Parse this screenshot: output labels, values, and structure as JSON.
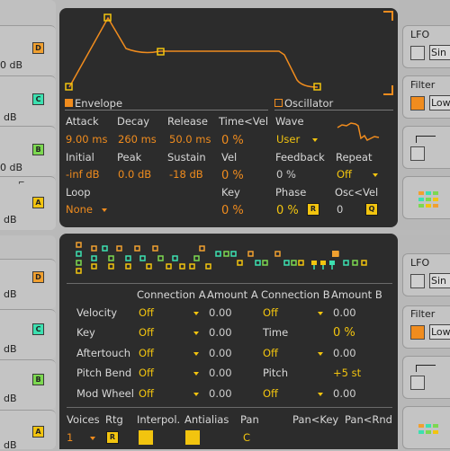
{
  "left_strip": {
    "ends": [
      "0 dB",
      "dB",
      "0 dB",
      "dB",
      "dB",
      "dB",
      "dB",
      "0 dB",
      "dB",
      "0 dB",
      "dB",
      "dB"
    ],
    "leds": [
      "D",
      "C",
      "B",
      "A",
      "D",
      "C",
      "B",
      "A"
    ]
  },
  "right_strip": {
    "lfo_label": "LFO",
    "lfo_value": "Sin",
    "filter_label": "Filter",
    "filter_value": "Low",
    "lfo2_label": "LFO",
    "lfo2_value": "Sin",
    "filter2_label": "Filter",
    "filter2_value": "Low"
  },
  "envelope": {
    "tab_label": "Envelope",
    "attack_label": "Attack",
    "attack_value": "9.00 ms",
    "decay_label": "Decay",
    "decay_value": "260 ms",
    "release_label": "Release",
    "release_value": "50.0 ms",
    "timevel_label": "Time<Vel",
    "timevel_value": "0 %",
    "initial_label": "Initial",
    "initial_value": "-inf dB",
    "peak_label": "Peak",
    "peak_value": "0.0 dB",
    "sustain_label": "Sustain",
    "sustain_value": "-18 dB",
    "vel_label": "Vel",
    "vel_value": "0 %",
    "loop_label": "Loop",
    "loop_value": "None",
    "key_label": "Key",
    "key_value": "0 %"
  },
  "oscillator": {
    "tab_label": "Oscillator",
    "wave_label": "Wave",
    "wave_value": "User",
    "feedback_label": "Feedback",
    "feedback_value": "0 %",
    "repeat_label": "Repeat",
    "repeat_value": "Off",
    "phase_label": "Phase",
    "phase_value": "0 %",
    "phase_btn": "R",
    "oscvel_label": "Osc<Vel",
    "oscvel_value": "0",
    "oscvel_btn": "Q"
  },
  "matrix": {
    "headers": [
      "Connection A",
      "Amount A",
      "Connection B",
      "Amount B"
    ],
    "rows": [
      {
        "label": "Velocity",
        "conn_a": "Off",
        "amt_a": "0.00",
        "conn_b": "Off",
        "amt_b": "0.00"
      },
      {
        "label": "Key",
        "conn_a": "Off",
        "amt_a": "0.00",
        "conn_b": "Time",
        "amt_b": "0 %"
      },
      {
        "label": "Aftertouch",
        "conn_a": "Off",
        "amt_a": "0.00",
        "conn_b": "Off",
        "amt_b": "0.00"
      },
      {
        "label": "Pitch Bend",
        "conn_a": "Off",
        "amt_a": "0.00",
        "conn_b": "Pitch",
        "amt_b": "+5 st"
      },
      {
        "label": "Mod Wheel",
        "conn_a": "Off",
        "amt_a": "0.00",
        "conn_b": "Off",
        "amt_b": "0.00"
      }
    ]
  },
  "global": {
    "voices_label": "Voices",
    "voices_value": "1",
    "rtg_label": "Rtg",
    "rtg_btn": "R",
    "interpol_label": "Interpol.",
    "antialias_label": "Antialias",
    "pan_label": "Pan",
    "pan_value": "C",
    "pankey_label": "Pan<Key",
    "panrnd_label": "Pan<Rnd"
  },
  "colors": {
    "orange": "#f08c1e",
    "yellow": "#f2c40f",
    "panel": "#2c2c2c",
    "led_d": "#f0a030",
    "led_c": "#3ce0b0",
    "led_b": "#7cd850",
    "led_a": "#f2c40f"
  }
}
